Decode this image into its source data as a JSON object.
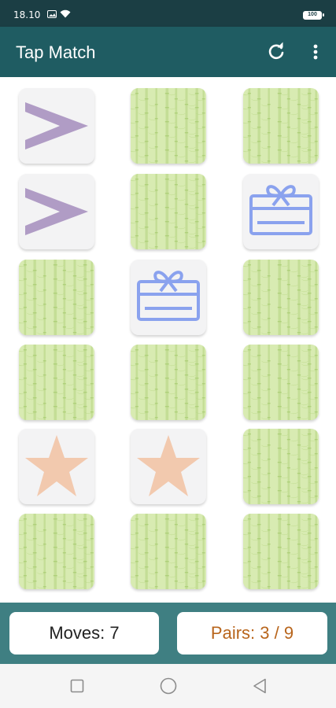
{
  "status": {
    "time": "18.10",
    "battery": "100"
  },
  "app": {
    "title": "Tap Match"
  },
  "icons": {
    "refresh": "refresh-icon",
    "more": "more-vert-icon",
    "back": "nav-back-icon",
    "home": "nav-home-icon",
    "recents": "nav-recents-icon"
  },
  "colors": {
    "appbar": "#1f5c62",
    "footer": "#3f7f82",
    "card_back": "#d8ebb2",
    "arrow": "#b09cc5",
    "gift": "#8aa2ee",
    "star": "#f2c9ae",
    "pairs_text": "#b8651c"
  },
  "board": {
    "columns": 3,
    "rows": 6,
    "cards": [
      {
        "state": "face-up",
        "symbol": "arrow"
      },
      {
        "state": "face-down",
        "symbol": ""
      },
      {
        "state": "face-down",
        "symbol": ""
      },
      {
        "state": "face-up",
        "symbol": "arrow"
      },
      {
        "state": "face-down",
        "symbol": ""
      },
      {
        "state": "face-up",
        "symbol": "gift"
      },
      {
        "state": "face-down",
        "symbol": ""
      },
      {
        "state": "face-up",
        "symbol": "gift"
      },
      {
        "state": "face-down",
        "symbol": ""
      },
      {
        "state": "face-down",
        "symbol": ""
      },
      {
        "state": "face-down",
        "symbol": ""
      },
      {
        "state": "face-down",
        "symbol": ""
      },
      {
        "state": "face-up",
        "symbol": "star"
      },
      {
        "state": "face-up",
        "symbol": "star"
      },
      {
        "state": "face-down",
        "symbol": ""
      },
      {
        "state": "face-down",
        "symbol": ""
      },
      {
        "state": "face-down",
        "symbol": ""
      },
      {
        "state": "face-down",
        "symbol": ""
      }
    ]
  },
  "score": {
    "moves_label": "Moves: 7",
    "pairs_label": "Pairs: 3 / 9"
  }
}
